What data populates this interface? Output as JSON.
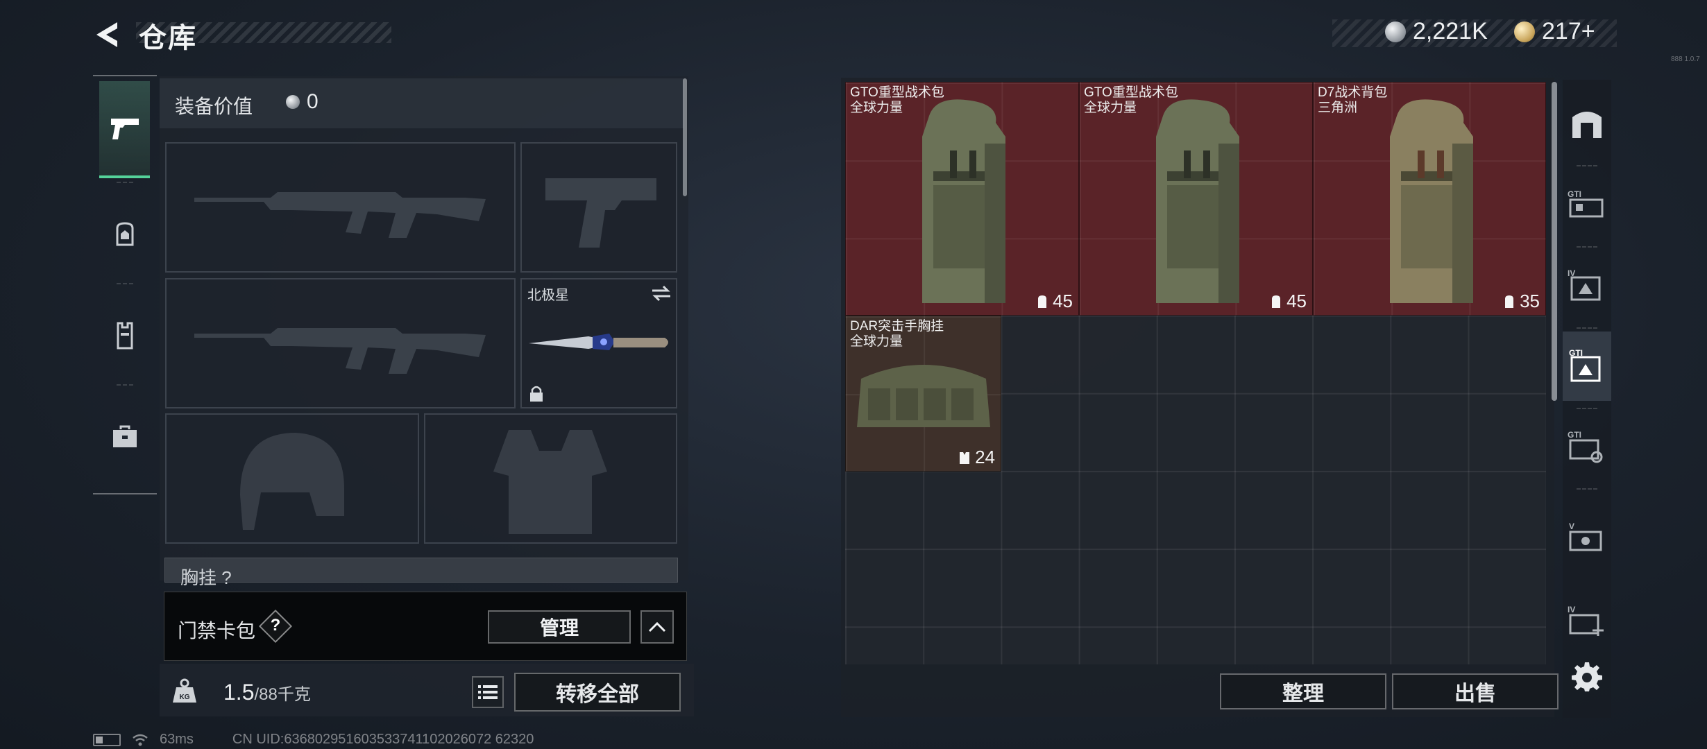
{
  "header": {
    "title": "仓库",
    "currency_silver": "2,221K",
    "currency_gold": "217+",
    "tiny_code": "888 1.0.7"
  },
  "left_tabs": [
    "weapon-tab",
    "backpack-tab",
    "armor-tab",
    "toolbox-tab"
  ],
  "equipment": {
    "value_label": "装备价值",
    "value": "0",
    "melee_slot_label": "北极星",
    "chest_label": "胸挂 ?"
  },
  "keycard": {
    "label": "门禁卡包",
    "help": "?",
    "manage_label": "管理"
  },
  "weight": {
    "current": "1.5",
    "max": "/88千克",
    "transfer_label": "转移全部"
  },
  "inventory": {
    "items": [
      {
        "name": "GTO重型战术包",
        "region": "全球力量",
        "capacity": "45",
        "rarity_color": "#5a2328"
      },
      {
        "name": "GTO重型战术包",
        "region": "全球力量",
        "capacity": "45",
        "rarity_color": "#5a2328"
      },
      {
        "name": "D7战术背包",
        "region": "三角洲",
        "capacity": "35",
        "rarity_color": "#5a2328"
      },
      {
        "name": "DAR突击手胸挂",
        "region": "全球力量",
        "capacity": "24",
        "rarity_color": "#3e302a"
      }
    ],
    "sort_label": "整理",
    "sell_label": "出售"
  },
  "right_rail": [
    "storage-icon",
    "gti-case-icon",
    "iv-case-icon",
    "gti-bag-icon",
    "gti-key-icon",
    "v-case-icon",
    "iv-add-icon",
    "settings-icon"
  ],
  "footer": {
    "ping": "63ms",
    "uid": "CN UID:636802951603533741102026072 62320"
  }
}
